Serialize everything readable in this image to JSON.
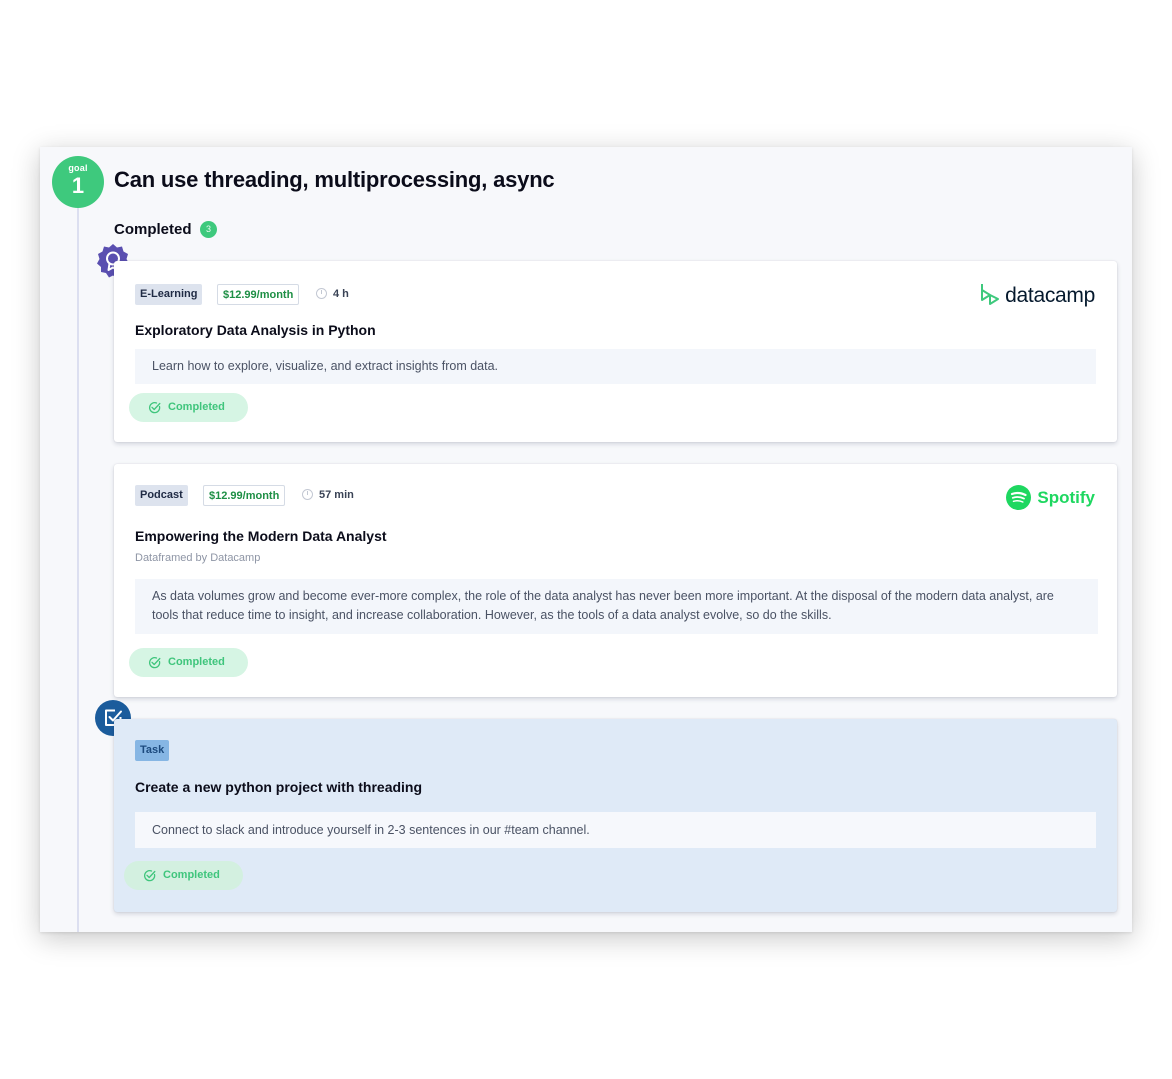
{
  "goal": {
    "badge_label": "goal",
    "number": "1",
    "title": "Can use threading, multiprocessing, async"
  },
  "section": {
    "label": "Completed",
    "count": "3"
  },
  "items": [
    {
      "type": "E-Learning",
      "price": "$12.99/month",
      "duration": "4 h",
      "title": "Exploratory Data Analysis in Python",
      "description": "Learn how to explore, visualize, and extract insights from data.",
      "status": "Completed",
      "provider": "datacamp",
      "icon": "award-icon"
    },
    {
      "type": "Podcast",
      "price": "$12.99/month",
      "duration": "57 min",
      "title": "Empowering the Modern Data Analyst",
      "subtitle": "Dataframed by Datacamp",
      "description": "As data volumes grow and become ever-more complex, the role of the data analyst has never been more important. At the disposal of the modern data analyst, are tools that reduce time to insight, and increase collaboration. However, as the tools of a data analyst evolve, so do the skills.",
      "status": "Completed",
      "provider": "Spotify"
    },
    {
      "type": "Task",
      "title": "Create a new python project with threading",
      "description": "Connect to slack and introduce yourself in 2-3 sentences in our #team channel.",
      "status": "Completed",
      "icon": "checkbox-icon"
    }
  ],
  "colors": {
    "green": "#3ec97d",
    "purple": "#5a4fb0",
    "navy": "#1b5c9c",
    "task_bg": "#dfeaf7"
  }
}
